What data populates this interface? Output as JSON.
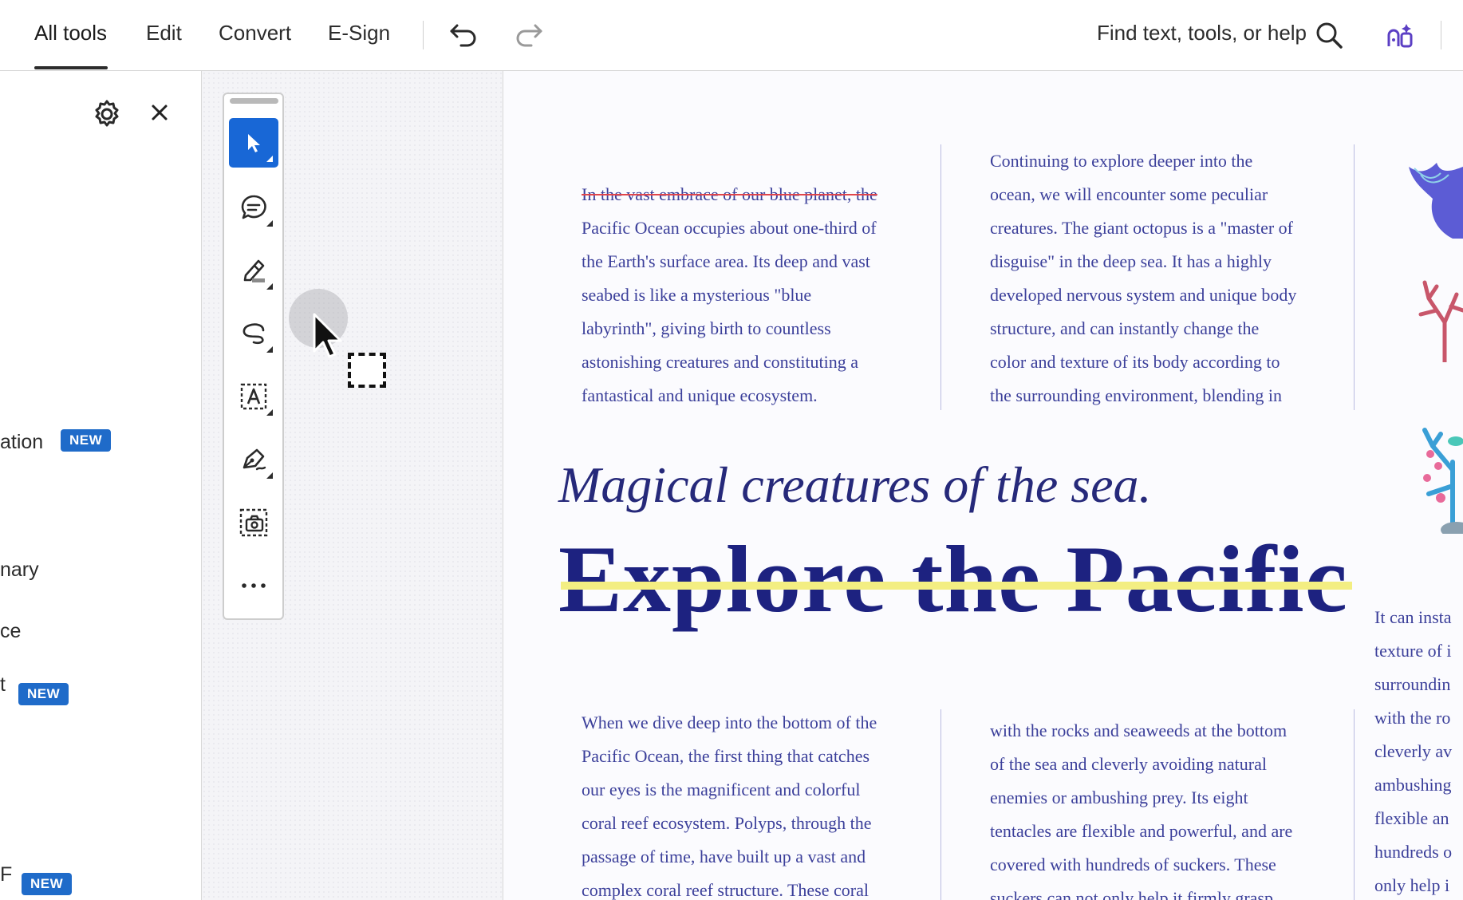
{
  "topbar": {
    "tabs": [
      {
        "label": "All tools",
        "active": true
      },
      {
        "label": "Edit",
        "active": false
      },
      {
        "label": "Convert",
        "active": false
      },
      {
        "label": "E-Sign",
        "active": false
      }
    ],
    "undo_icon": "undo-icon",
    "redo_icon": "redo-icon",
    "search_label": "Find text, tools, or help",
    "search_icon": "search-icon",
    "ai_icon": "ai-assistant-icon"
  },
  "left_panel": {
    "settings_icon": "gear-icon",
    "close_icon": "close-icon",
    "items": [
      {
        "label": "ation",
        "badge": "NEW"
      },
      {
        "label": "nary",
        "badge": ""
      },
      {
        "label": "ce",
        "badge": ""
      },
      {
        "label": "t",
        "badge": "NEW"
      },
      {
        "label": "F",
        "badge": "NEW"
      }
    ]
  },
  "toolbar": {
    "tools": [
      {
        "name": "select-tool",
        "icon": "arrow-cursor-icon",
        "selected": true
      },
      {
        "name": "comment-tool",
        "icon": "comment-icon",
        "selected": false
      },
      {
        "name": "highlight-tool",
        "icon": "highlighter-icon",
        "selected": false
      },
      {
        "name": "draw-tool",
        "icon": "freehand-icon",
        "selected": false
      },
      {
        "name": "text-select-tool",
        "icon": "text-box-icon",
        "selected": false
      },
      {
        "name": "sign-tool",
        "icon": "pen-sign-icon",
        "selected": false
      },
      {
        "name": "snapshot-tool",
        "icon": "camera-snapshot-icon",
        "selected": false
      },
      {
        "name": "more-tools",
        "icon": "ellipsis-icon",
        "selected": false
      }
    ]
  },
  "document": {
    "col1_top": {
      "strike": "In the vast embrace of our blue planet, the",
      "text": "Pacific Ocean occupies about one-third of\nthe Earth's surface area. Its deep and vast\nseabed is like a mysterious \"blue\nlabyrinth\", giving birth to countless\nastonishing creatures and constituting a\nfantastical and unique ecosystem."
    },
    "col2_top": "Continuing to explore deeper into the\nocean, we will encounter some peculiar\ncreatures. The giant octopus is a \"master of\ndisguise\" in the deep sea. It has a highly\ndeveloped nervous system and unique body\nstructure, and can instantly change the\ncolor and texture of its body according to\nthe surrounding environment, blending in",
    "subtitle": "Magical creatures of the sea.",
    "headline": "Explore the Pacific",
    "col3_right": "It can insta\ntexture of i\nsurroundin\nwith the ro\ncleverly av\nambushing\nflexible an\nhundreds o\nonly help i",
    "col1_bottom": "When we dive deep into the bottom of the\nPacific Ocean, the first thing that catches\nour eyes is the magnificent and colorful\ncoral reef ecosystem. Polyps, through the\npassage of time, have built up a vast and\ncomplex coral reef structure. These coral",
    "col2_bottom": "with the rocks and seaweeds at the bottom\nof the sea and cleverly avoiding natural\nenemies or ambushing prey. Its eight\ntentacles are flexible and powerful, and are\ncovered with hundreds of suckers. These\nsuckers can not only help it firmly grasp"
  },
  "colors": {
    "accent": "#1867d6",
    "badge": "#1f6bc9",
    "doc_text": "#3b3f9a",
    "headline": "#1d2280",
    "strike_red": "#e0454b",
    "highlight_yellow": "#f3ee82"
  }
}
